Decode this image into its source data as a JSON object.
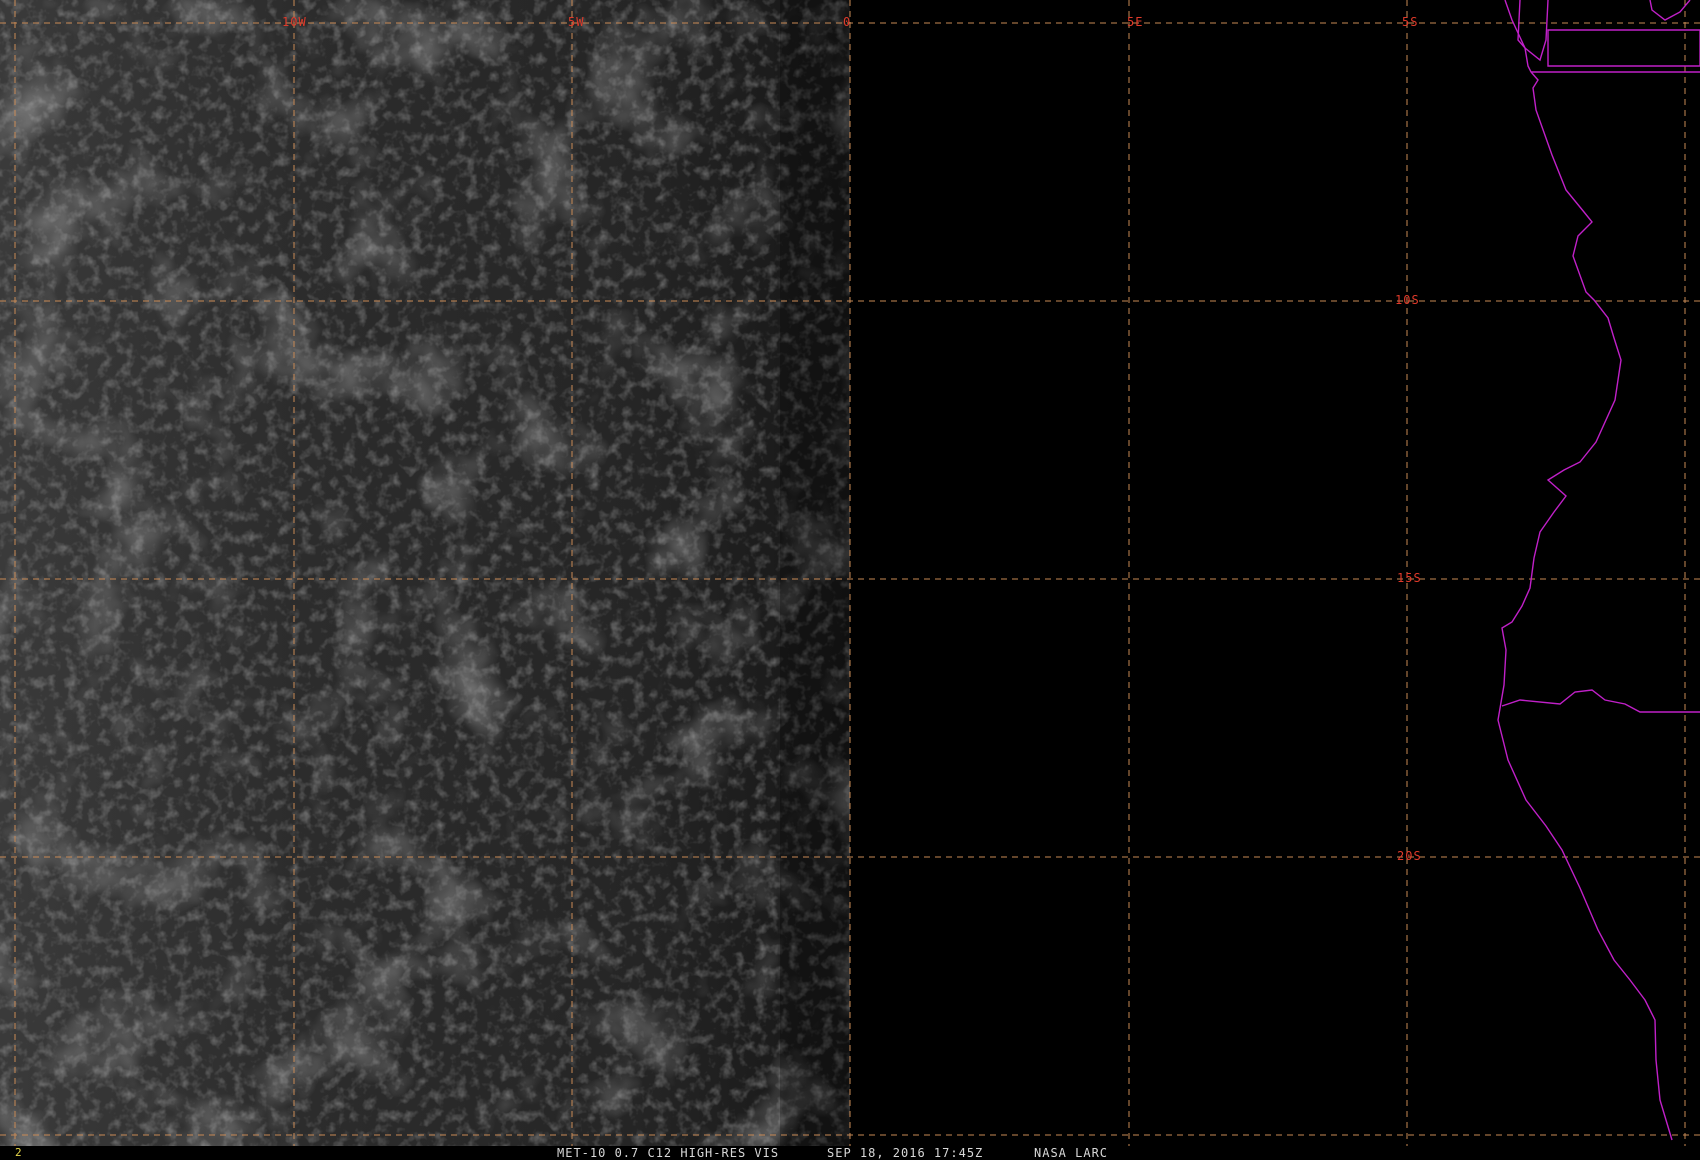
{
  "map": {
    "grid_labels": {
      "longitudes": [
        "10W",
        "5W",
        "0",
        "5E"
      ],
      "latitudes": [
        "5S",
        "10S",
        "15S",
        "20S"
      ]
    },
    "colors": {
      "grid": "#c98a55",
      "grid_label": "#e03a2a",
      "coastline": "#c020c8",
      "night_side": "#000000"
    }
  },
  "status": {
    "frame_number": "2",
    "product": "MET-10 0.7 C12 HIGH-RES VIS",
    "timestamp": "SEP 18, 2016 17:45Z",
    "credit": "NASA LARC"
  }
}
